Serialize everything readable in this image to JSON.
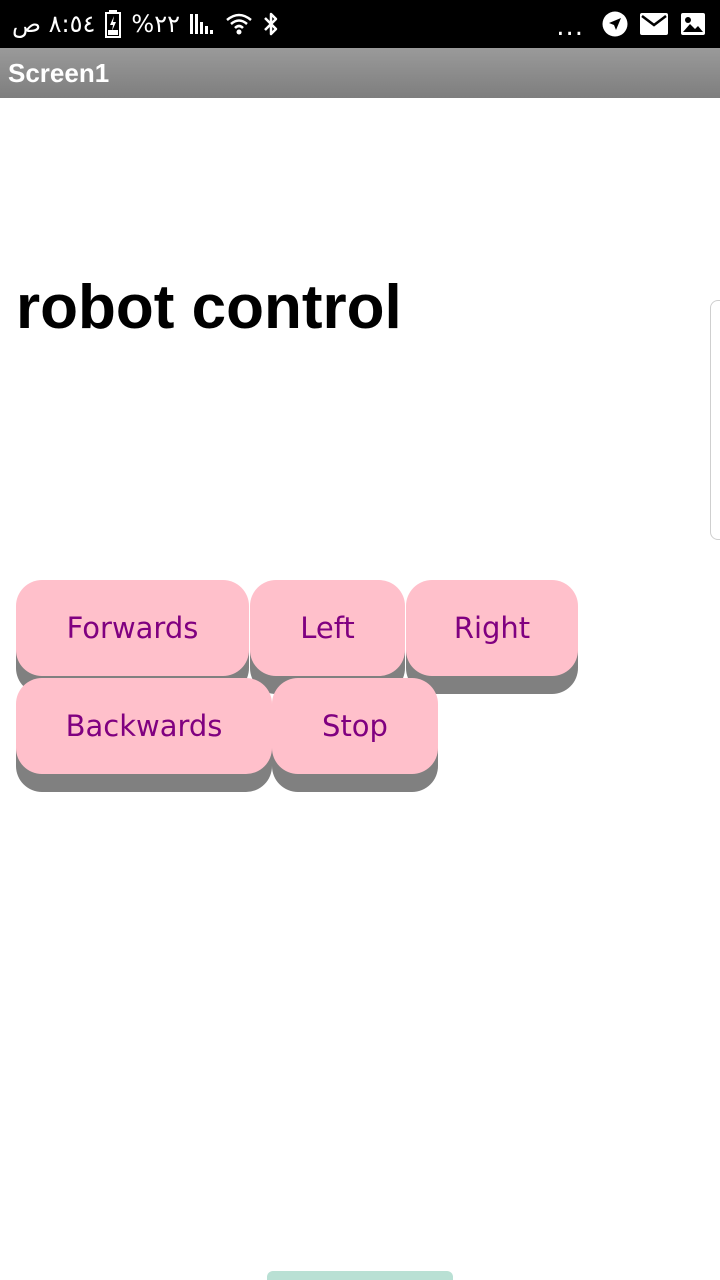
{
  "status_bar": {
    "time": "٨:٥٤ ص",
    "battery": "%٢٢",
    "icons": [
      "battery-icon",
      "signal-icon",
      "wifi-icon",
      "bluetooth-icon",
      "more-dots-icon",
      "navigation-icon",
      "mail-icon",
      "image-icon"
    ],
    "more": "..."
  },
  "title_bar": {
    "title": "Screen1"
  },
  "main": {
    "heading": "robot control",
    "buttons": {
      "forwards": "Forwards",
      "left": "Left",
      "right": "Right",
      "backwards": "Backwards",
      "stop": "Stop"
    }
  },
  "colors": {
    "button_bg": "#ffc0cb",
    "button_text": "#800080",
    "button_shadow": "#808080",
    "title_bar": "#8c8c8c",
    "status_bar": "#000000"
  }
}
